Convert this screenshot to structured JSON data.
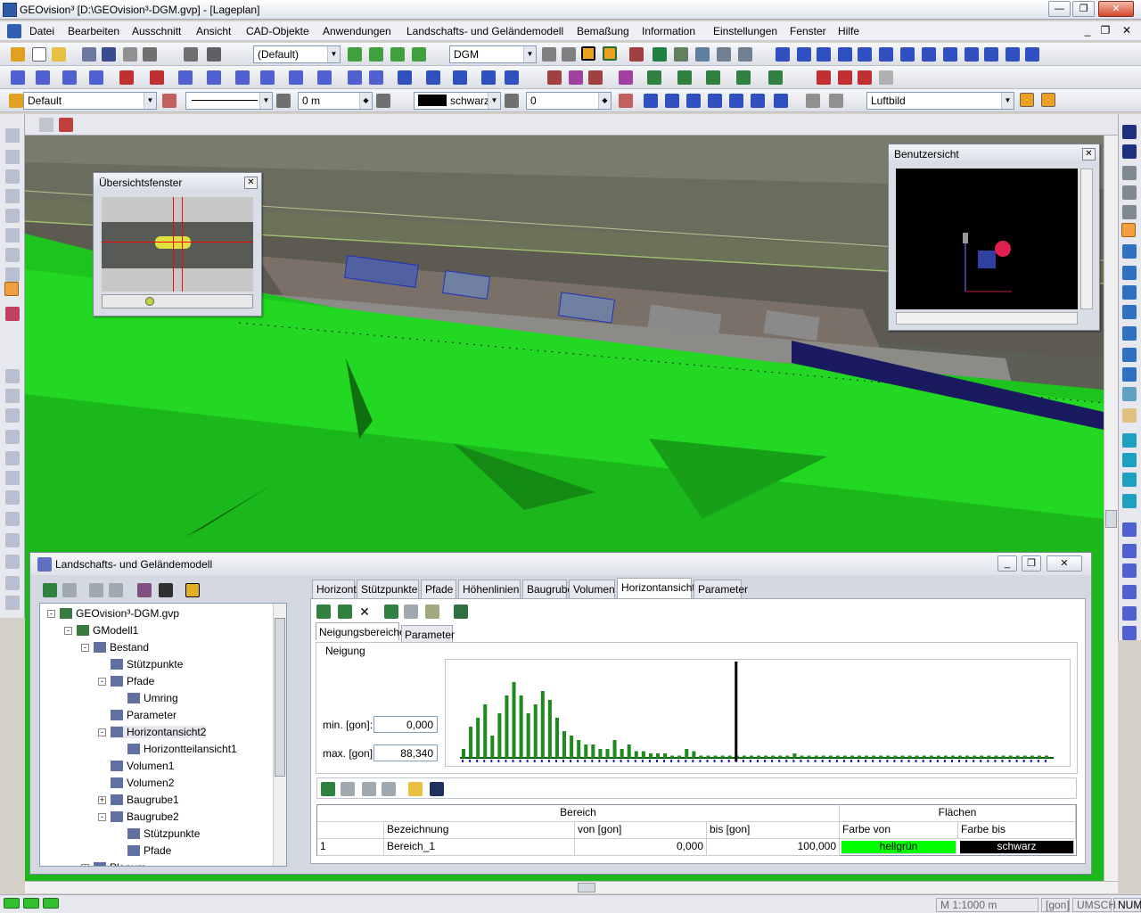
{
  "window": {
    "title": "GEOvision³  [D:\\GEOvision³-DGM.gvp] - [Lageplan]",
    "min": "—",
    "max": "❐",
    "close": "✕"
  },
  "menu": [
    "Datei",
    "Bearbeiten",
    "Ausschnitt",
    "Ansicht",
    "CAD-Objekte",
    "Anwendungen",
    "Landschafts- und Geländemodell",
    "Bemaßung",
    "Information",
    "Einstellungen",
    "Fenster",
    "Hilfe"
  ],
  "mdi": {
    "min": "_",
    "restore": "❐",
    "close": "✕"
  },
  "toolbar": {
    "view_combo": "(Default)",
    "layer_combo": "DGM",
    "style_combo": "Default",
    "offset_value": "0 m",
    "color_value": "schwarz",
    "angle_value": "0",
    "background_combo": "Luftbild"
  },
  "overview": {
    "title": "Übersichtsfenster",
    "close": "✕"
  },
  "userview": {
    "title": "Benutzersicht",
    "close": "✕"
  },
  "lgm": {
    "title": "Landschafts- und Geländemodell",
    "tree": [
      {
        "label": "GEOvision³-DGM.gvp",
        "level": 0,
        "toggle": "-"
      },
      {
        "label": "GModell1",
        "level": 1,
        "toggle": "-"
      },
      {
        "label": "Bestand",
        "level": 2,
        "toggle": "-"
      },
      {
        "label": "Stützpunkte",
        "level": 3,
        "toggle": ""
      },
      {
        "label": "Pfade",
        "level": 3,
        "toggle": "-"
      },
      {
        "label": "Umring",
        "level": 4,
        "toggle": ""
      },
      {
        "label": "Parameter",
        "level": 3,
        "toggle": ""
      },
      {
        "label": "Horizontansicht2",
        "level": 3,
        "toggle": "-",
        "selected": true
      },
      {
        "label": "Horizontteilansicht1",
        "level": 4,
        "toggle": ""
      },
      {
        "label": "Volumen1",
        "level": 3,
        "toggle": ""
      },
      {
        "label": "Volumen2",
        "level": 3,
        "toggle": ""
      },
      {
        "label": "Baugrube1",
        "level": 3,
        "toggle": "+"
      },
      {
        "label": "Baugrube2",
        "level": 3,
        "toggle": "-"
      },
      {
        "label": "Stützpunkte",
        "level": 4,
        "toggle": ""
      },
      {
        "label": "Pfade",
        "level": 4,
        "toggle": ""
      },
      {
        "label": "Planum",
        "level": 2,
        "toggle": "+"
      }
    ],
    "tabs": [
      "Horizont",
      "Stützpunkte",
      "Pfade",
      "Höhenlinien",
      "Baugrube",
      "Volumen",
      "Horizontansicht",
      "Parameter"
    ],
    "active_tab": "Horizontansicht",
    "subtabs": [
      "Neigungsbereiche",
      "Parameter"
    ],
    "group_label": "Neigung",
    "min_label": "min. [gon]:",
    "min_value": "0,000",
    "max_label": "max. [gon]:",
    "max_value": "88,340",
    "table": {
      "group_headers": [
        "Bereich",
        "Flächen"
      ],
      "columns": [
        "",
        "Bezeichnung",
        "von [gon]",
        "bis [gon]",
        "Farbe von",
        "Farbe bis"
      ],
      "rows": [
        {
          "nr": "1",
          "name": "Bereich_1",
          "von": "0,000",
          "bis": "100,000",
          "farbe_von": "hellgrün",
          "farbe_bis": "schwarz",
          "color_from": "#00ff00",
          "color_to": "#000000"
        }
      ]
    }
  },
  "chart_data": {
    "type": "bar",
    "values": [
      4,
      14,
      18,
      24,
      10,
      20,
      28,
      34,
      28,
      20,
      24,
      30,
      26,
      18,
      12,
      10,
      8,
      6,
      6,
      4,
      4,
      8,
      4,
      6,
      3,
      3,
      2,
      2,
      2,
      1,
      1,
      4,
      3,
      1,
      1,
      1,
      1,
      1,
      1,
      1,
      1,
      1,
      1,
      1,
      1,
      1,
      2,
      1,
      1,
      1,
      1,
      1,
      1,
      1,
      1,
      1,
      1,
      1,
      1,
      1,
      1,
      1,
      1,
      1,
      1,
      1,
      1,
      1,
      1,
      1,
      1,
      1,
      1,
      1,
      1,
      1,
      1,
      1,
      1,
      1,
      1,
      1
    ],
    "ymax": 40,
    "marker_index": 38,
    "title": "",
    "xlabel": "",
    "ylabel": ""
  },
  "status": {
    "scale": "M 1:1000  m",
    "unit": "[gon]",
    "caps": "UMSCH",
    "num": "NUM"
  }
}
